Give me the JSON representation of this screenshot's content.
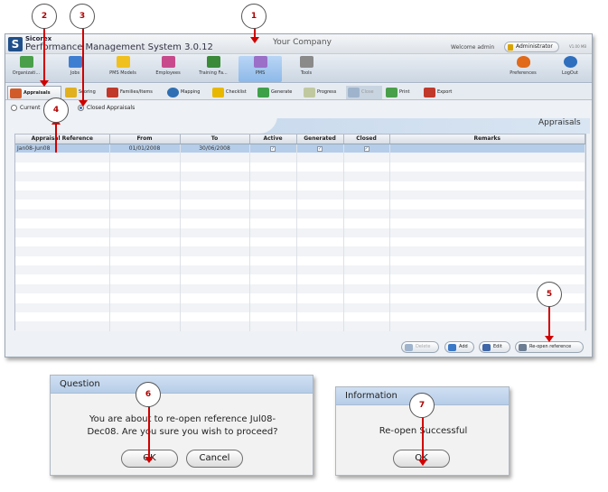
{
  "app": {
    "brand": "Sicorex",
    "product": "Performance Management System 3.0.12",
    "company": "Your Company",
    "welcome": "Welcome admin",
    "admin_label": "Administrator",
    "version": "V1.00 MB"
  },
  "toolbar": [
    {
      "label": "Organizati...",
      "icon": "organization-icon",
      "color": "#4aa04a"
    },
    {
      "label": "Jobs",
      "icon": "jobs-icon",
      "color": "#3f7fd1"
    },
    {
      "label": "PMS Models",
      "icon": "pms-models-icon",
      "color": "#f0c020"
    },
    {
      "label": "Employees",
      "icon": "employees-icon",
      "color": "#c84a8c"
    },
    {
      "label": "Training Fa...",
      "icon": "training-icon",
      "color": "#3a8a3a"
    },
    {
      "label": "PMS",
      "icon": "pms-icon",
      "color": "#9b6fc8"
    },
    {
      "label": "Tools",
      "icon": "tools-icon",
      "color": "#8a8a8a"
    },
    {
      "label": "Preferences",
      "icon": "preferences-icon",
      "color": "#e06a1a"
    },
    {
      "label": "LogOut",
      "icon": "logout-icon",
      "color": "#2f6fbe"
    }
  ],
  "tabs": [
    {
      "label": "Appraisals",
      "icon": "appraisals-icon",
      "color": "#d25b2a"
    },
    {
      "label": "Scoring",
      "icon": "scoring-icon",
      "color": "#e0b020"
    },
    {
      "label": "Families/Items",
      "icon": "families-items-icon",
      "color": "#c0392b"
    },
    {
      "label": "Mapping",
      "icon": "mapping-icon",
      "color": "#2e6fb3"
    },
    {
      "label": "Checklist",
      "icon": "checklist-icon",
      "color": "#e8b800"
    },
    {
      "label": "Generate",
      "icon": "generate-icon",
      "color": "#3fa04a"
    },
    {
      "label": "Progress",
      "icon": "progress-icon",
      "color": "#c0c8a0"
    },
    {
      "label": "Close",
      "icon": "close-appraisal-icon",
      "color": "#9fb4cc"
    },
    {
      "label": "Print",
      "icon": "print-icon",
      "color": "#4aa04a"
    },
    {
      "label": "Export",
      "icon": "export-icon",
      "color": "#c0392b"
    }
  ],
  "radios": {
    "current": "Current",
    "closed": "Closed Appraisals"
  },
  "panel_title": "Appraisals",
  "grid": {
    "headers": [
      "Appraisal Reference",
      "From",
      "To",
      "Active",
      "Generated",
      "Closed",
      "Remarks"
    ],
    "rows": [
      {
        "reference": "Jan08-Jun08",
        "from": "01/01/2008",
        "to": "30/06/2008",
        "active": "✓",
        "generated": "✓",
        "closed": "✓",
        "remarks": ""
      }
    ]
  },
  "buttons": {
    "delete": "Delete",
    "add": "Add",
    "edit": "Edit",
    "reopen": "Re-open reference"
  },
  "question_dialog": {
    "title": "Question",
    "message_line1": "You are about to re-open reference Jul08-",
    "message_line2": "Dec08. Are you sure you wish to proceed?",
    "ok": "OK",
    "cancel": "Cancel"
  },
  "info_dialog": {
    "title": "Information",
    "message": "Re-open Successful",
    "ok": "OK"
  },
  "markers": [
    "1",
    "2",
    "3",
    "4",
    "5",
    "6",
    "7"
  ]
}
